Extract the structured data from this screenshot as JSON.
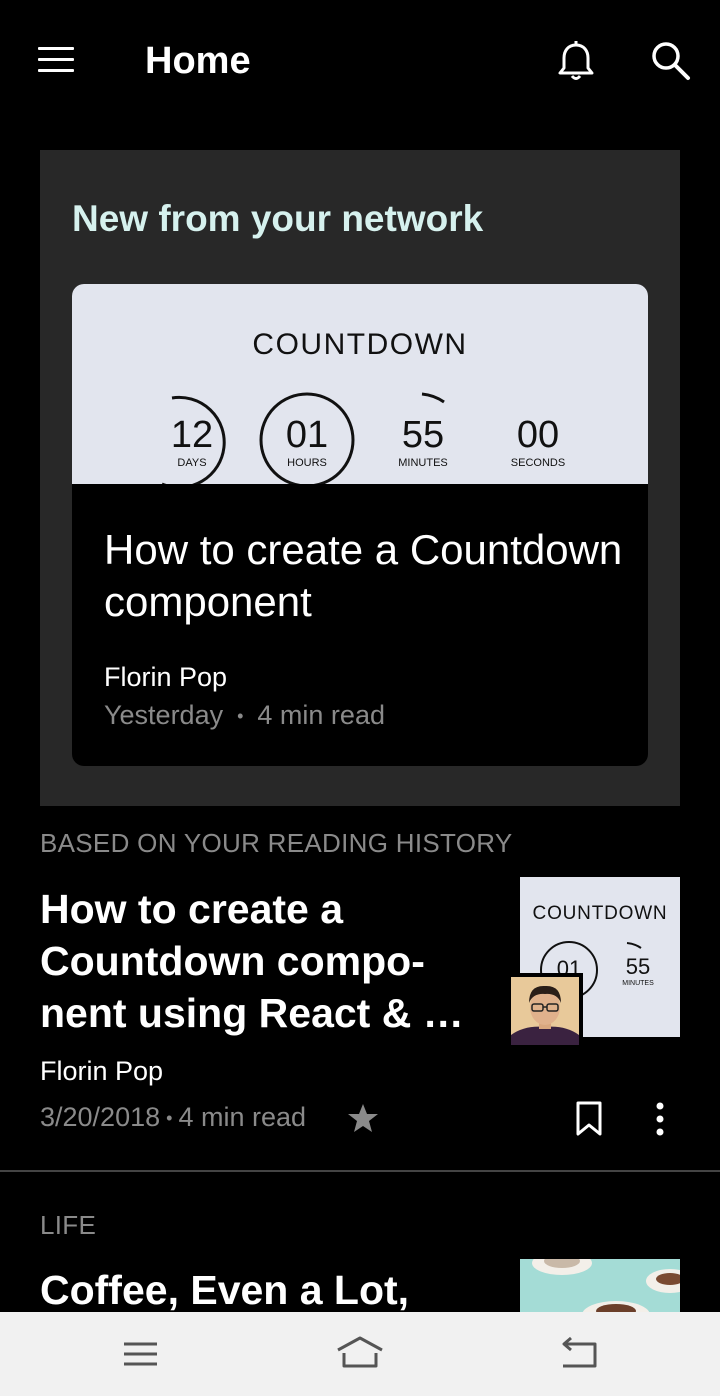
{
  "header": {
    "title": "Home",
    "icons": {
      "menu": "hamburger-menu-icon",
      "notifications": "bell-icon",
      "search": "search-icon"
    }
  },
  "network": {
    "heading": "New from your network",
    "feature": {
      "image": {
        "title": "COUNTDOWN",
        "units": [
          {
            "value": "12",
            "label": "DAYS"
          },
          {
            "value": "01",
            "label": "HOURS"
          },
          {
            "value": "55",
            "label": "MINUTES"
          },
          {
            "value": "00",
            "label": "SECONDS"
          }
        ]
      },
      "title": "How to create a Countdown component",
      "author": "Florin Pop",
      "date": "Yesterday",
      "separator": "•",
      "read_time": "4 min read"
    }
  },
  "reading_history": {
    "label": "BASED ON YOUR READING HISTORY",
    "article": {
      "title": "How to create a Countdown compo-nent using React & …",
      "title_lines": [
        "How to create a",
        "Countdown compo-",
        "nent using React & …"
      ],
      "author": "Florin Pop",
      "date": "3/20/2018",
      "separator": "•",
      "read_time": "4 min read",
      "thumbnail": {
        "title": "COUNTDOWN",
        "values": [
          "01",
          "55"
        ],
        "minutes_label": "MINUTES"
      },
      "icons": {
        "star": "star-icon",
        "bookmark": "bookmark-icon",
        "more": "more-vertical-icon"
      }
    }
  },
  "life": {
    "label": "LIFE",
    "article": {
      "title": "Coffee, Even a Lot,"
    }
  },
  "system_nav": {
    "icons": [
      "recent-apps-icon",
      "home-icon",
      "back-icon"
    ]
  },
  "colors": {
    "background": "#000000",
    "card": "#282828",
    "heading_accent": "#d6f1ee",
    "muted_text": "#8a8a8a",
    "nav_bar": "#f1f1f1"
  }
}
